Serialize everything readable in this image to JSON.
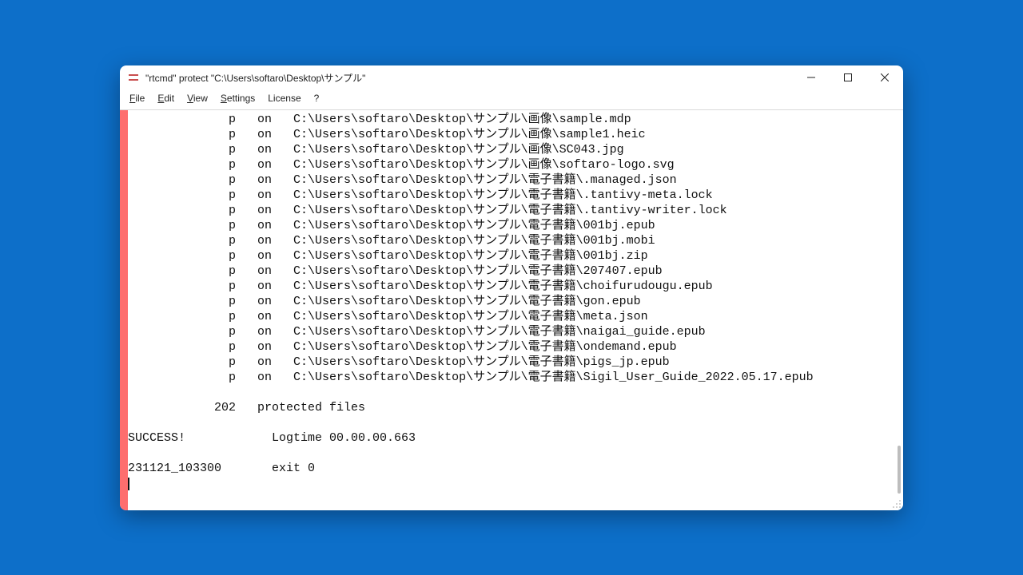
{
  "window": {
    "title": "\"rtcmd\" protect \"C:\\Users\\softaro\\Desktop\\サンプル\""
  },
  "menu": {
    "file": "File",
    "edit": "Edit",
    "view": "View",
    "settings": "Settings",
    "license": "License",
    "help": "?"
  },
  "console": {
    "entry_marker": "p",
    "entry_state": "on",
    "base_path": "C:\\Users\\softaro\\Desktop\\サンプル\\",
    "files": [
      "画像\\sample.mdp",
      "画像\\sample1.heic",
      "画像\\SC043.jpg",
      "画像\\softaro-logo.svg",
      "電子書籍\\.managed.json",
      "電子書籍\\.tantivy-meta.lock",
      "電子書籍\\.tantivy-writer.lock",
      "電子書籍\\001bj.epub",
      "電子書籍\\001bj.mobi",
      "電子書籍\\001bj.zip",
      "電子書籍\\207407.epub",
      "電子書籍\\choifurudougu.epub",
      "電子書籍\\gon.epub",
      "電子書籍\\meta.json",
      "電子書籍\\naigai_guide.epub",
      "電子書籍\\ondemand.epub",
      "電子書籍\\pigs_jp.epub",
      "電子書籍\\Sigil_User_Guide_2022.05.17.epub"
    ],
    "summary_count": "202",
    "summary_label": "protected files",
    "success_label": "SUCCESS!",
    "logtime_label": "Logtime",
    "logtime_value": "00.00.00.663",
    "timestamp": "231121_103300",
    "exit_label": "exit 0"
  }
}
